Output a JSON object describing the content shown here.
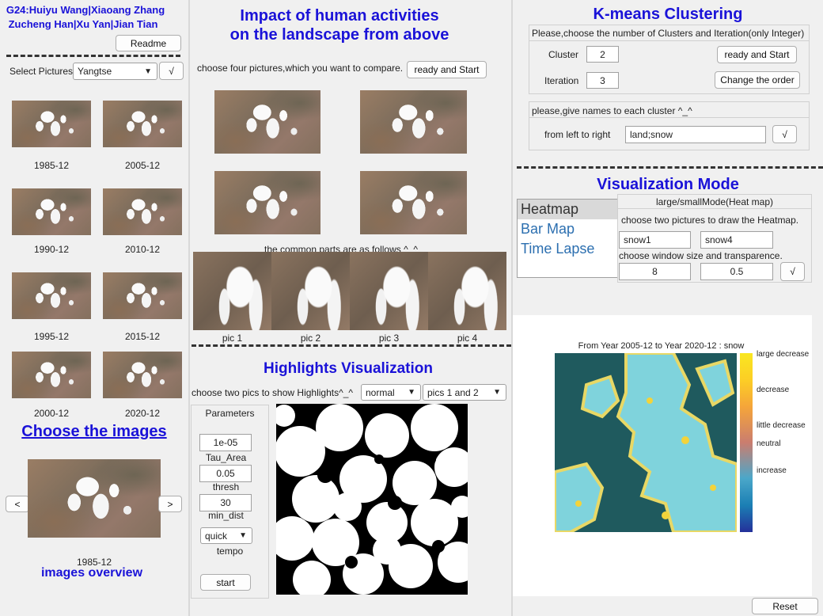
{
  "left": {
    "authors_line1": "G24:Huiyu Wang|Xiaoang Zhang",
    "authors_line2": "Zucheng Han|Xu Yan|Jian Tian",
    "readme_label": "Readme",
    "select_label": "Select Pictures",
    "select_value": "Yangtse",
    "confirm_label": "√",
    "thumbs": [
      {
        "caption": "1985-12"
      },
      {
        "caption": "2005-12"
      },
      {
        "caption": "1990-12"
      },
      {
        "caption": "2010-12"
      },
      {
        "caption": "1995-12"
      },
      {
        "caption": "2015-12"
      },
      {
        "caption": "2000-12"
      },
      {
        "caption": "2020-12"
      }
    ],
    "choose_title": "Choose the images",
    "prev_label": "<",
    "next_label": ">",
    "preview_caption": "1985-12",
    "overview_title": "images overview"
  },
  "middle": {
    "title_line1": "Impact of human activities",
    "title_line2": "on the landscape from above",
    "choose_text": "choose four pictures,which you want to compare.",
    "ready_label": "ready and Start",
    "common_text": "the common parts are as follows ^_^",
    "pics": [
      "pic 1",
      "pic 2",
      "pic 3",
      "pic 4"
    ],
    "highlights_title": "Highlights Visualization",
    "highlights_text": "choose two pics to show Highlights^_^",
    "mode_value": "normal",
    "pics_value": "pics 1 and 2",
    "params": {
      "title": "Parameters",
      "tau_value": "1e-05",
      "tau_label": "Tau_Area",
      "thresh_value": "0.05",
      "thresh_label": "thresh",
      "min_dist_value": "30",
      "min_dist_label": "min_dist",
      "tempo_value": "quick",
      "tempo_label": "tempo",
      "start_label": "start"
    }
  },
  "right": {
    "kmeans_title": "K-means Clustering",
    "kmeans_prompt": "Please,choose the number of Clusters and Iteration(only Integer)",
    "cluster_label": "Cluster",
    "cluster_value": "2",
    "iteration_label": "Iteration",
    "iteration_value": "3",
    "ready_label": "ready and Start",
    "change_order_label": "Change the order",
    "names_prompt": "please,give names to each cluster ^_^",
    "left_right_label": "from left to right",
    "names_value": "land;snow",
    "names_confirm": "√",
    "vis_title": "Visualization Mode",
    "modes": [
      "Heatmap",
      "Bar Map",
      "Time Lapse"
    ],
    "mode_header": "large/smallMode(Heat map)",
    "heat_prompt": "choose two pictures to draw the Heatmap.",
    "pic_a": "snow1",
    "pic_b": "snow4",
    "window_prompt": "choose window size and transparence.",
    "window_value": "8",
    "transparence_value": "0.5",
    "heat_confirm": "√",
    "heatmap_title": "From Year 2005-12 to Year 2020-12 : snow",
    "colorbar_ticks": [
      "large decrease",
      "decrease",
      "little decrease",
      "neutral",
      "increase"
    ],
    "reset_label": "Reset"
  }
}
